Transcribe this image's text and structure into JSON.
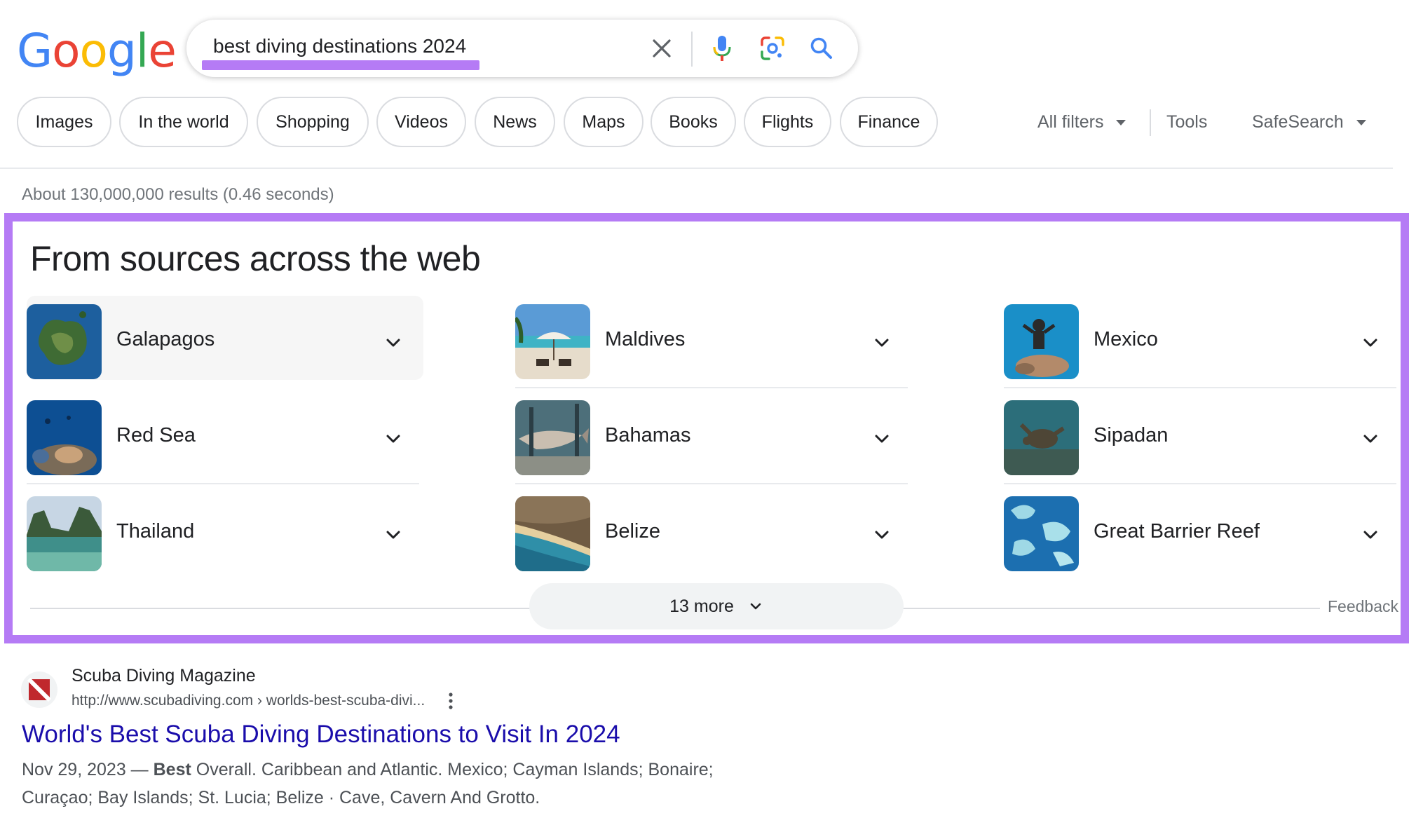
{
  "logo": {
    "letters": [
      "G",
      "o",
      "o",
      "g",
      "l",
      "e"
    ],
    "colors": [
      "#4285f4",
      "#ea4335",
      "#fbbc05",
      "#4285f4",
      "#34a853",
      "#ea4335"
    ]
  },
  "search": {
    "query": "best diving destinations 2024",
    "icons": [
      "close-icon",
      "mic-icon",
      "lens-icon",
      "search-icon"
    ]
  },
  "chips": [
    "Images",
    "In the world",
    "Shopping",
    "Videos",
    "News",
    "Maps",
    "Books",
    "Flights",
    "Finance"
  ],
  "tools": {
    "all_filters": "All filters",
    "tools": "Tools",
    "safesearch": "SafeSearch"
  },
  "stats": "About 130,000,000 results (0.46 seconds)",
  "panel": {
    "title": "From sources across the web",
    "items": [
      {
        "label": "Galapagos"
      },
      {
        "label": "Maldives"
      },
      {
        "label": "Mexico"
      },
      {
        "label": "Red Sea"
      },
      {
        "label": "Bahamas"
      },
      {
        "label": "Sipadan"
      },
      {
        "label": "Thailand"
      },
      {
        "label": "Belize"
      },
      {
        "label": "Great Barrier Reef"
      }
    ],
    "more_label": "13 more",
    "feedback": "Feedback"
  },
  "result": {
    "site_name": "Scuba Diving Magazine",
    "url": "http://www.scubadiving.com › worlds-best-scuba-divi...",
    "title": "World's Best Scuba Diving Destinations to Visit In 2024",
    "date": "Nov 29, 2023 —",
    "snippet_bold": "Best",
    "snippet_line1": " Overall. Caribbean and Atlantic. Mexico; Cayman Islands; Bonaire;",
    "snippet_line2": "Curaçao; Bay Islands; St. Lucia; Belize · Cave, Cavern And Grotto."
  },
  "colors": {
    "highlight": "#b57bf5",
    "link": "#1a0dab"
  }
}
